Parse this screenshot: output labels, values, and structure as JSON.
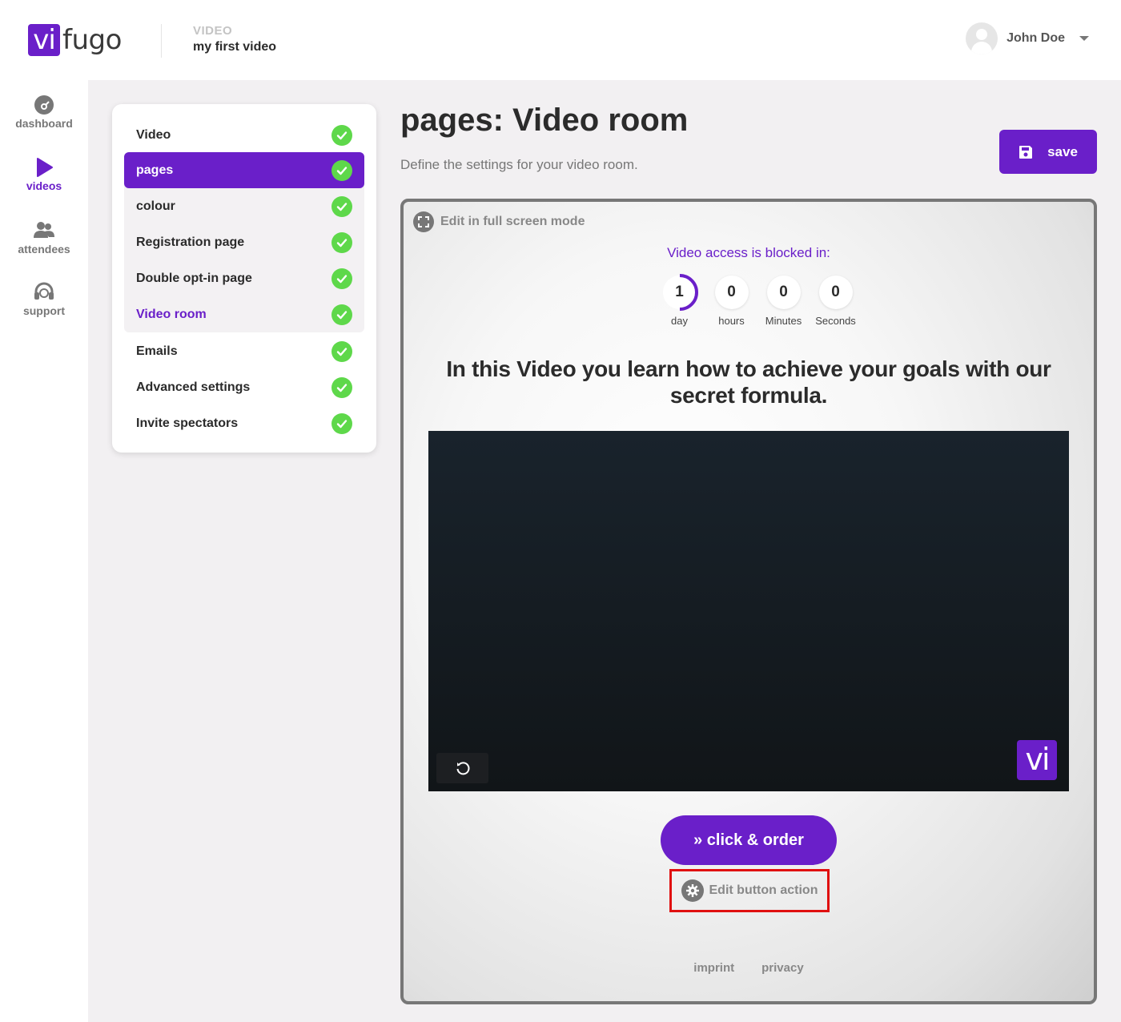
{
  "header": {
    "logo_vi": "vi",
    "logo_fugo": "fugo",
    "breadcrumb_kicker": "VIDEO",
    "breadcrumb_title": "my first video",
    "user_name": "John Doe"
  },
  "leftnav": {
    "items": [
      {
        "label": "dashboard",
        "icon": "gauge-icon",
        "active": false
      },
      {
        "label": "videos",
        "icon": "play-icon",
        "active": true
      },
      {
        "label": "attendees",
        "icon": "users-icon",
        "active": false
      },
      {
        "label": "support",
        "icon": "headset-icon",
        "active": false
      }
    ]
  },
  "steps": {
    "items": [
      {
        "label": "Video",
        "done": true
      },
      {
        "label": "pages",
        "done": true,
        "active": true
      },
      {
        "label": "colour",
        "done": true
      },
      {
        "label": "Registration page",
        "done": true
      },
      {
        "label": "Double opt-in page",
        "done": true
      },
      {
        "label": "Video room",
        "done": true,
        "current": true
      },
      {
        "label": "Emails",
        "done": true
      },
      {
        "label": "Advanced settings",
        "done": true
      },
      {
        "label": "Invite spectators",
        "done": true
      }
    ]
  },
  "page": {
    "title": "pages: Video room",
    "subtitle": "Define the settings for your video room.",
    "save_label": "save"
  },
  "preview": {
    "fullscreen_label": "Edit in full screen mode",
    "blocked_text": "Video access is blocked in:",
    "countdown": [
      {
        "value": "1",
        "label": "day"
      },
      {
        "value": "0",
        "label": "hours"
      },
      {
        "value": "0",
        "label": "Minutes"
      },
      {
        "value": "0",
        "label": "Seconds"
      }
    ],
    "headline": "In this Video you learn how to achieve your goals with our secret formula.",
    "video_logo": "vi",
    "order_button": "» click & order",
    "edit_button_action": "Edit button action",
    "footer": {
      "imprint": "imprint",
      "privacy": "privacy"
    }
  },
  "colors": {
    "brand": "#6a1fc9",
    "check": "#5ed84a",
    "highlight": "#e01010"
  }
}
